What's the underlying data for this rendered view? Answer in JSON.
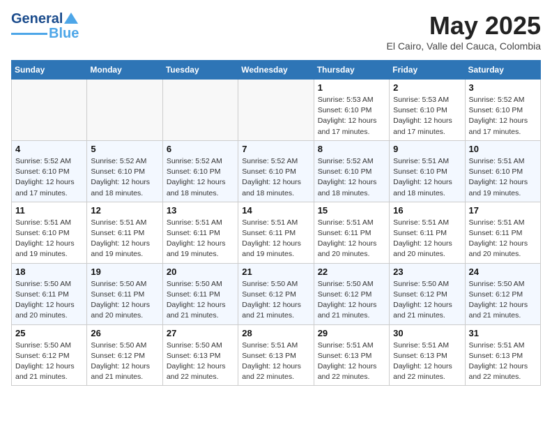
{
  "header": {
    "logo_line1": "General",
    "logo_line2": "Blue",
    "title": "May 2025",
    "location": "El Cairo, Valle del Cauca, Colombia"
  },
  "weekdays": [
    "Sunday",
    "Monday",
    "Tuesday",
    "Wednesday",
    "Thursday",
    "Friday",
    "Saturday"
  ],
  "weeks": [
    [
      {
        "day": "",
        "empty": true
      },
      {
        "day": "",
        "empty": true
      },
      {
        "day": "",
        "empty": true
      },
      {
        "day": "",
        "empty": true
      },
      {
        "day": "1",
        "sunrise": "5:53 AM",
        "sunset": "6:10 PM",
        "daylight": "12 hours and 17 minutes."
      },
      {
        "day": "2",
        "sunrise": "5:53 AM",
        "sunset": "6:10 PM",
        "daylight": "12 hours and 17 minutes."
      },
      {
        "day": "3",
        "sunrise": "5:52 AM",
        "sunset": "6:10 PM",
        "daylight": "12 hours and 17 minutes."
      }
    ],
    [
      {
        "day": "4",
        "sunrise": "5:52 AM",
        "sunset": "6:10 PM",
        "daylight": "12 hours and 17 minutes."
      },
      {
        "day": "5",
        "sunrise": "5:52 AM",
        "sunset": "6:10 PM",
        "daylight": "12 hours and 18 minutes."
      },
      {
        "day": "6",
        "sunrise": "5:52 AM",
        "sunset": "6:10 PM",
        "daylight": "12 hours and 18 minutes."
      },
      {
        "day": "7",
        "sunrise": "5:52 AM",
        "sunset": "6:10 PM",
        "daylight": "12 hours and 18 minutes."
      },
      {
        "day": "8",
        "sunrise": "5:52 AM",
        "sunset": "6:10 PM",
        "daylight": "12 hours and 18 minutes."
      },
      {
        "day": "9",
        "sunrise": "5:51 AM",
        "sunset": "6:10 PM",
        "daylight": "12 hours and 18 minutes."
      },
      {
        "day": "10",
        "sunrise": "5:51 AM",
        "sunset": "6:10 PM",
        "daylight": "12 hours and 19 minutes."
      }
    ],
    [
      {
        "day": "11",
        "sunrise": "5:51 AM",
        "sunset": "6:10 PM",
        "daylight": "12 hours and 19 minutes."
      },
      {
        "day": "12",
        "sunrise": "5:51 AM",
        "sunset": "6:11 PM",
        "daylight": "12 hours and 19 minutes."
      },
      {
        "day": "13",
        "sunrise": "5:51 AM",
        "sunset": "6:11 PM",
        "daylight": "12 hours and 19 minutes."
      },
      {
        "day": "14",
        "sunrise": "5:51 AM",
        "sunset": "6:11 PM",
        "daylight": "12 hours and 19 minutes."
      },
      {
        "day": "15",
        "sunrise": "5:51 AM",
        "sunset": "6:11 PM",
        "daylight": "12 hours and 20 minutes."
      },
      {
        "day": "16",
        "sunrise": "5:51 AM",
        "sunset": "6:11 PM",
        "daylight": "12 hours and 20 minutes."
      },
      {
        "day": "17",
        "sunrise": "5:51 AM",
        "sunset": "6:11 PM",
        "daylight": "12 hours and 20 minutes."
      }
    ],
    [
      {
        "day": "18",
        "sunrise": "5:50 AM",
        "sunset": "6:11 PM",
        "daylight": "12 hours and 20 minutes."
      },
      {
        "day": "19",
        "sunrise": "5:50 AM",
        "sunset": "6:11 PM",
        "daylight": "12 hours and 20 minutes."
      },
      {
        "day": "20",
        "sunrise": "5:50 AM",
        "sunset": "6:11 PM",
        "daylight": "12 hours and 21 minutes."
      },
      {
        "day": "21",
        "sunrise": "5:50 AM",
        "sunset": "6:12 PM",
        "daylight": "12 hours and 21 minutes."
      },
      {
        "day": "22",
        "sunrise": "5:50 AM",
        "sunset": "6:12 PM",
        "daylight": "12 hours and 21 minutes."
      },
      {
        "day": "23",
        "sunrise": "5:50 AM",
        "sunset": "6:12 PM",
        "daylight": "12 hours and 21 minutes."
      },
      {
        "day": "24",
        "sunrise": "5:50 AM",
        "sunset": "6:12 PM",
        "daylight": "12 hours and 21 minutes."
      }
    ],
    [
      {
        "day": "25",
        "sunrise": "5:50 AM",
        "sunset": "6:12 PM",
        "daylight": "12 hours and 21 minutes."
      },
      {
        "day": "26",
        "sunrise": "5:50 AM",
        "sunset": "6:12 PM",
        "daylight": "12 hours and 21 minutes."
      },
      {
        "day": "27",
        "sunrise": "5:50 AM",
        "sunset": "6:13 PM",
        "daylight": "12 hours and 22 minutes."
      },
      {
        "day": "28",
        "sunrise": "5:51 AM",
        "sunset": "6:13 PM",
        "daylight": "12 hours and 22 minutes."
      },
      {
        "day": "29",
        "sunrise": "5:51 AM",
        "sunset": "6:13 PM",
        "daylight": "12 hours and 22 minutes."
      },
      {
        "day": "30",
        "sunrise": "5:51 AM",
        "sunset": "6:13 PM",
        "daylight": "12 hours and 22 minutes."
      },
      {
        "day": "31",
        "sunrise": "5:51 AM",
        "sunset": "6:13 PM",
        "daylight": "12 hours and 22 minutes."
      }
    ]
  ]
}
